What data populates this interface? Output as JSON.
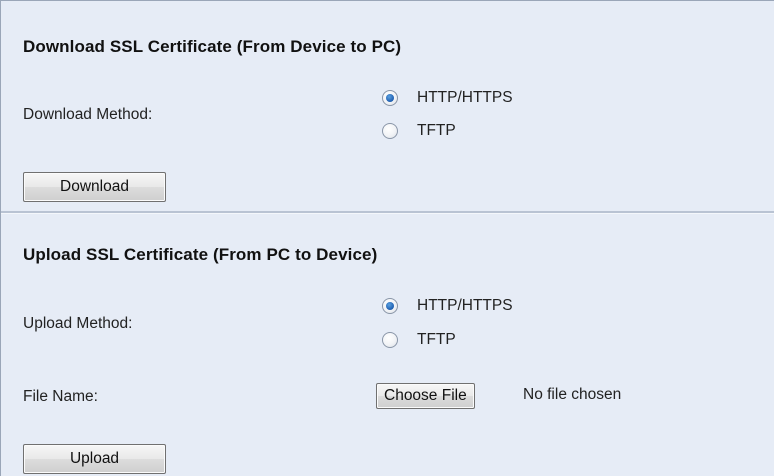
{
  "download": {
    "title": "Download SSL Certificate (From Device to PC)",
    "method_label": "Download Method:",
    "options": [
      {
        "label": "HTTP/HTTPS",
        "checked": true
      },
      {
        "label": "TFTP",
        "checked": false
      }
    ],
    "button_label": "Download"
  },
  "upload": {
    "title": "Upload SSL Certificate (From PC to Device)",
    "method_label": "Upload Method:",
    "options": [
      {
        "label": "HTTP/HTTPS",
        "checked": true
      },
      {
        "label": "TFTP",
        "checked": false
      }
    ],
    "file_name_label": "File Name:",
    "choose_file_label": "Choose File",
    "file_status": "No file chosen",
    "button_label": "Upload"
  },
  "colors": {
    "background": "#e6ecf6",
    "radio_selected": "#1e5eb0",
    "divider": "#b9c3d3"
  }
}
